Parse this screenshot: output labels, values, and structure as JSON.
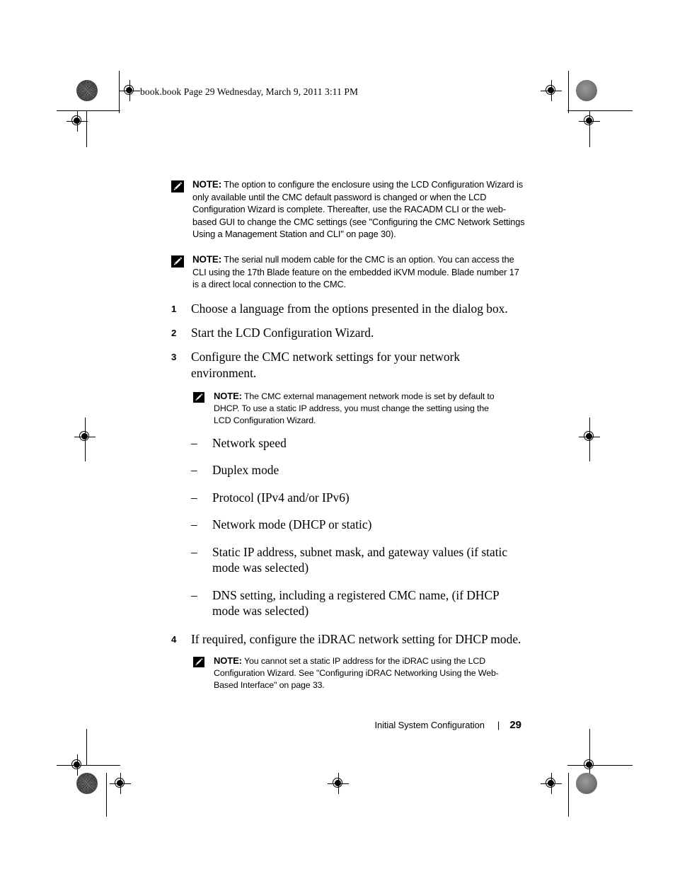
{
  "header": {
    "file_info": "book.book  Page 29  Wednesday, March 9, 2011  3:11 PM"
  },
  "notes": {
    "label": "NOTE:",
    "note1": "The option to configure the enclosure using the LCD Configuration Wizard is only available until the CMC default password is changed or when the LCD Configuration Wizard is complete. Thereafter, use the RACADM CLI or the web-based GUI to change the CMC settings (see \"Configuring the CMC Network Settings Using a Management Station and CLI\" on page 30).",
    "note2": "The serial null modem cable for the CMC is an option. You can access the CLI using the 17th Blade feature on the embedded iKVM module. Blade number 17 is a direct local connection to the CMC.",
    "note3": "The CMC external management network mode is set by default to DHCP. To use a static IP address, you must change the setting using the LCD Configuration Wizard.",
    "note4": "You cannot set a static IP address for the iDRAC using the LCD Configuration Wizard. See \"Configuring iDRAC Networking Using the Web-Based Interface\" on page 33."
  },
  "steps": [
    {
      "num": "1",
      "text": "Choose a language from the options presented in the dialog box."
    },
    {
      "num": "2",
      "text": "Start the LCD Configuration Wizard."
    },
    {
      "num": "3",
      "text": "Configure the CMC network settings for your network environment."
    },
    {
      "num": "4",
      "text": "If required, configure the iDRAC network setting for DHCP mode."
    }
  ],
  "sub_items": {
    "dash": "–",
    "items": [
      "Network speed",
      "Duplex mode",
      "Protocol (IPv4 and/or IPv6)",
      "Network mode (DHCP or static)",
      "Static IP address, subnet mask, and gateway values (if static mode was selected)",
      "DNS setting, including a registered CMC name, (if DHCP mode was selected)"
    ]
  },
  "footer": {
    "title": "Initial System Configuration",
    "separator": "|",
    "page_number": "29"
  }
}
